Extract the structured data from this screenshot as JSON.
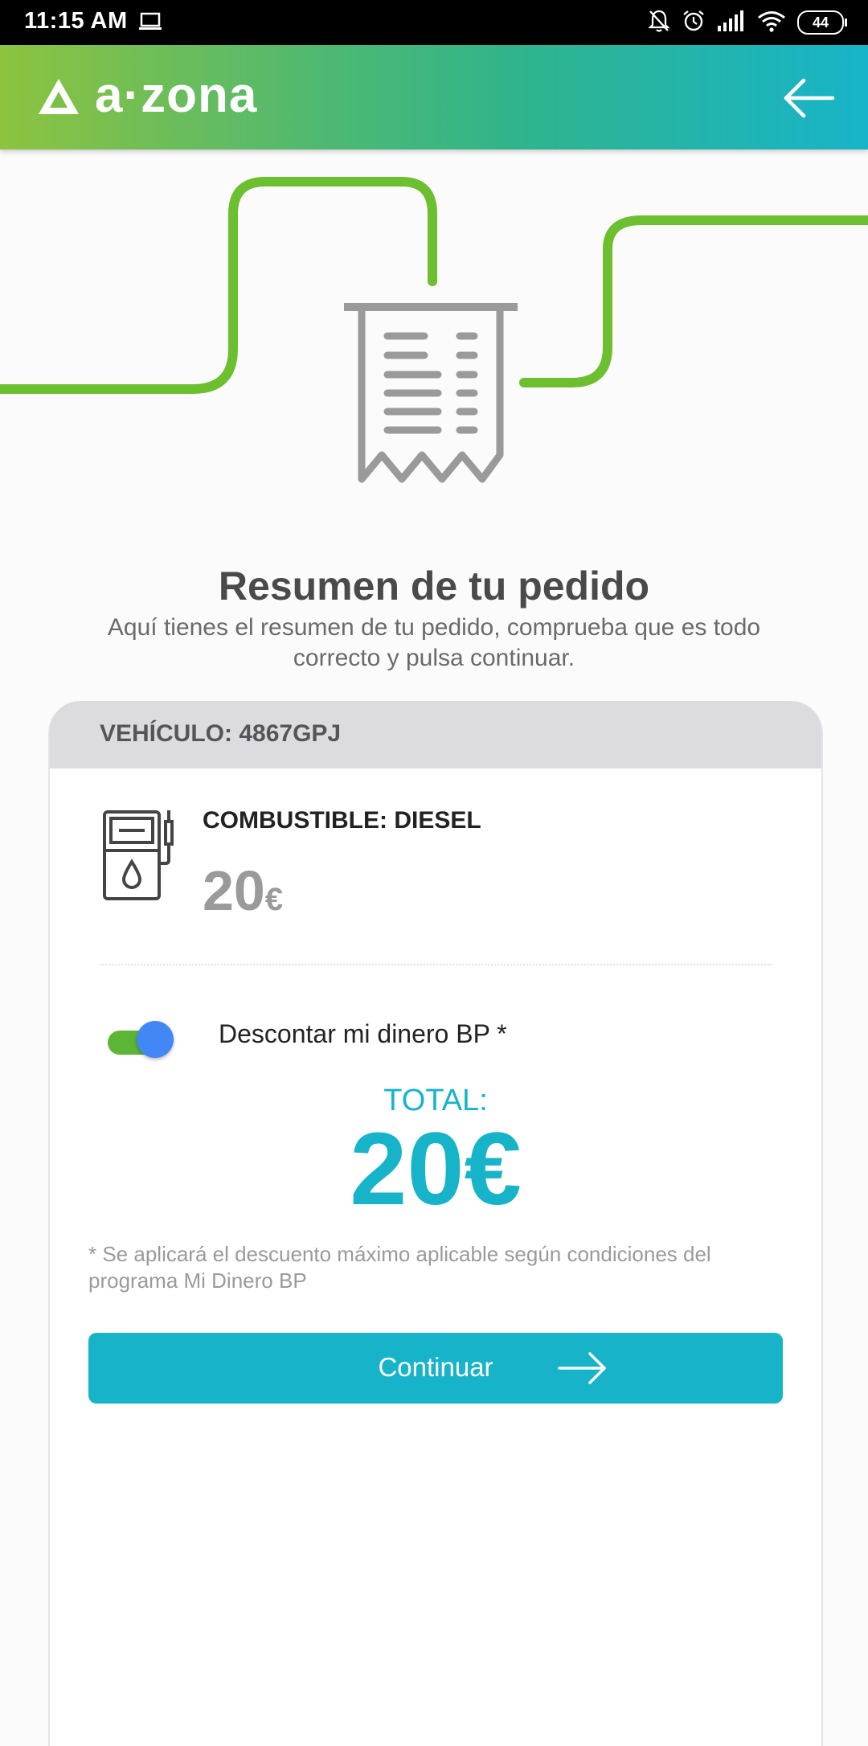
{
  "status_bar": {
    "time": "11:15 AM",
    "battery": "44",
    "icons": [
      "laptop-icon",
      "bell-off-icon",
      "alarm-icon",
      "signal-icon",
      "wifi-icon",
      "battery-icon"
    ]
  },
  "header": {
    "logo_text": "a·zona",
    "back_icon": "arrow-left-icon"
  },
  "colors": {
    "brand_green": "#8dc33f",
    "brand_teal": "#17b4c9",
    "toggle_on": "#5cb534",
    "toggle_knob": "#4287f5"
  },
  "summary": {
    "title": "Resumen de tu pedido",
    "subtitle": "Aquí tienes el resumen de tu pedido, comprueba que es todo correcto y pulsa continuar."
  },
  "order": {
    "vehicle_label": "VEHÍCULO: 4867GPJ",
    "fuel_label": "COMBUSTIBLE: DIESEL",
    "fuel_amount": "20",
    "fuel_currency": "€",
    "discount_toggle_label": "Descontar mi dinero BP *",
    "discount_toggle_on": true,
    "total_label": "TOTAL:",
    "total_value": "20€",
    "note": "* Se aplicará el descuento máximo aplicable según condiciones del programa Mi Dinero BP",
    "continue_label": "Continuar"
  }
}
